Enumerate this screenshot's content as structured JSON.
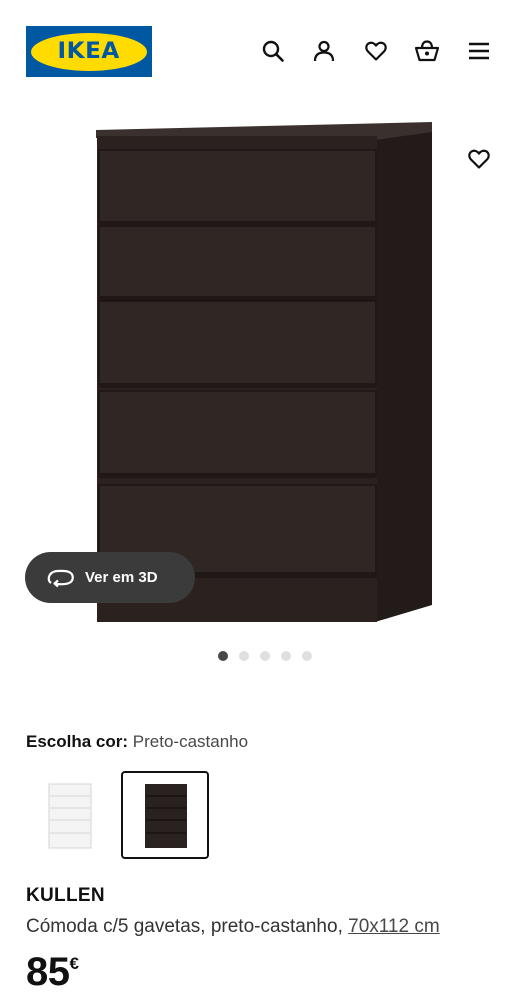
{
  "header": {
    "logo_text": "IKEA",
    "icons": [
      "search-icon",
      "user-icon",
      "heart-icon",
      "shopping-bag-icon",
      "menu-icon"
    ]
  },
  "hero": {
    "product_color": "#2a2220",
    "favourite_icon": "heart-icon",
    "view_3d_label": "Ver em 3D",
    "view_3d_icon": "rotate-3d-icon",
    "carousel": {
      "total": 5,
      "active": 1
    }
  },
  "color_picker": {
    "label": "Escolha cor:",
    "selected_value": "Preto-castanho",
    "swatches": [
      {
        "name": "white",
        "color": "#f7f7f7",
        "selected": false
      },
      {
        "name": "black-brown",
        "color": "#2a2220",
        "selected": true
      }
    ]
  },
  "product": {
    "name": "KULLEN",
    "description": "Cómoda c/5 gavetas, preto-castanho,",
    "dimensions": "70x112 cm",
    "price_integer": "85",
    "price_currency": "€"
  },
  "colors": {
    "ikea_blue": "#0058a3",
    "ikea_yellow": "#ffdb00",
    "pill_bg": "#3b3b3b"
  }
}
